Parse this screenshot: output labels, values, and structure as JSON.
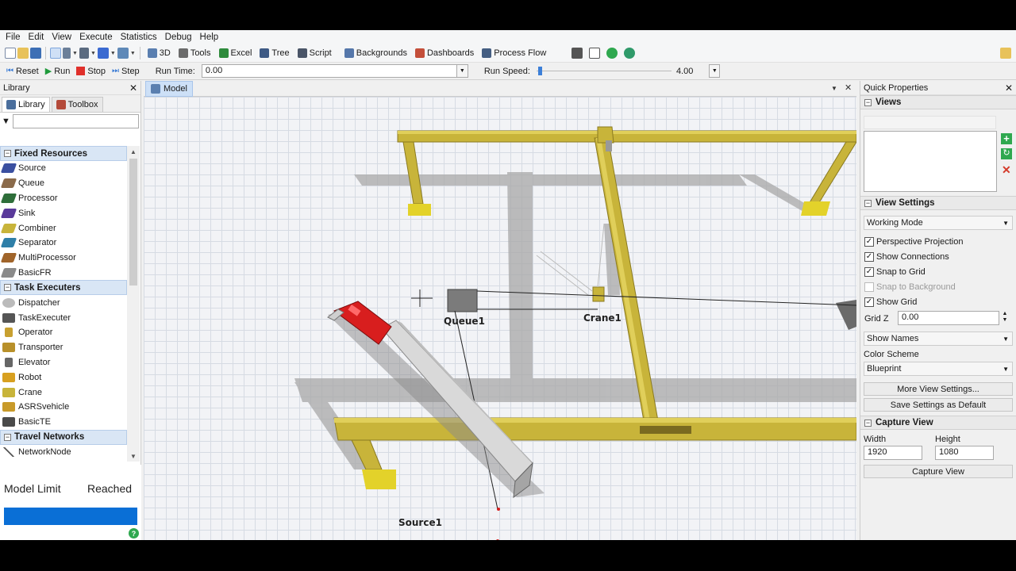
{
  "menu": [
    "File",
    "Edit",
    "View",
    "Execute",
    "Statistics",
    "Debug",
    "Help"
  ],
  "toolbar": {
    "items": [
      {
        "label": "3D",
        "icon": "grid-3d-icon"
      },
      {
        "label": "Tools",
        "icon": "tools-icon"
      },
      {
        "label": "Excel",
        "icon": "excel-icon"
      },
      {
        "label": "Tree",
        "icon": "tree-icon"
      },
      {
        "label": "Script",
        "icon": "script-icon"
      },
      {
        "label": "Backgrounds",
        "icon": "backgrounds-icon"
      },
      {
        "label": "Dashboards",
        "icon": "dashboards-icon"
      },
      {
        "label": "Process Flow",
        "icon": "process-flow-icon"
      }
    ]
  },
  "run_controls": {
    "reset": "Reset",
    "run": "Run",
    "stop": "Stop",
    "step": "Step",
    "run_time_label": "Run Time:",
    "run_time_value": "0.00",
    "run_speed_label": "Run Speed:",
    "run_speed_value": "4.00"
  },
  "library": {
    "title": "Library",
    "tabs": [
      "Library",
      "Toolbox"
    ],
    "categories": [
      {
        "name": "Fixed Resources",
        "items": [
          "Source",
          "Queue",
          "Processor",
          "Sink",
          "Combiner",
          "Separator",
          "MultiProcessor",
          "BasicFR"
        ]
      },
      {
        "name": "Task Executers",
        "items": [
          "Dispatcher",
          "TaskExecuter",
          "Operator",
          "Transporter",
          "Elevator",
          "Robot",
          "Crane",
          "ASRSvehicle",
          "BasicTE"
        ]
      },
      {
        "name": "Travel Networks",
        "items": [
          "NetworkNode"
        ]
      }
    ],
    "model_limit": "Model Limit",
    "reached": "Reached"
  },
  "model": {
    "tab": "Model",
    "objects": {
      "queue": "Queue1",
      "crane": "Crane1",
      "source": "Source1"
    }
  },
  "quick_properties": {
    "title": "Quick Properties",
    "views_section": "Views",
    "view_settings_section": "View Settings",
    "working_mode": "Working Mode",
    "checkboxes": [
      {
        "label": "Perspective Projection",
        "checked": true,
        "enabled": true
      },
      {
        "label": "Show Connections",
        "checked": true,
        "enabled": true
      },
      {
        "label": "Snap to Grid",
        "checked": true,
        "enabled": true
      },
      {
        "label": "Snap to Background",
        "checked": false,
        "enabled": false
      },
      {
        "label": "Show Grid",
        "checked": true,
        "enabled": true
      }
    ],
    "grid_z_label": "Grid Z",
    "grid_z_value": "0.00",
    "show_names": "Show Names",
    "color_scheme_label": "Color Scheme",
    "color_scheme_value": "Blueprint",
    "more_view_settings": "More View Settings...",
    "save_settings": "Save Settings as Default",
    "capture_section": "Capture View",
    "width_label": "Width",
    "height_label": "Height",
    "width_value": "1920",
    "height_value": "1080",
    "capture_button": "Capture View"
  },
  "colors": {
    "crane_yellow": "#c8b43a",
    "selection_blue": "#d9e6f5",
    "progress_blue": "#0a6fd6",
    "truck_red": "#d81e1e"
  }
}
